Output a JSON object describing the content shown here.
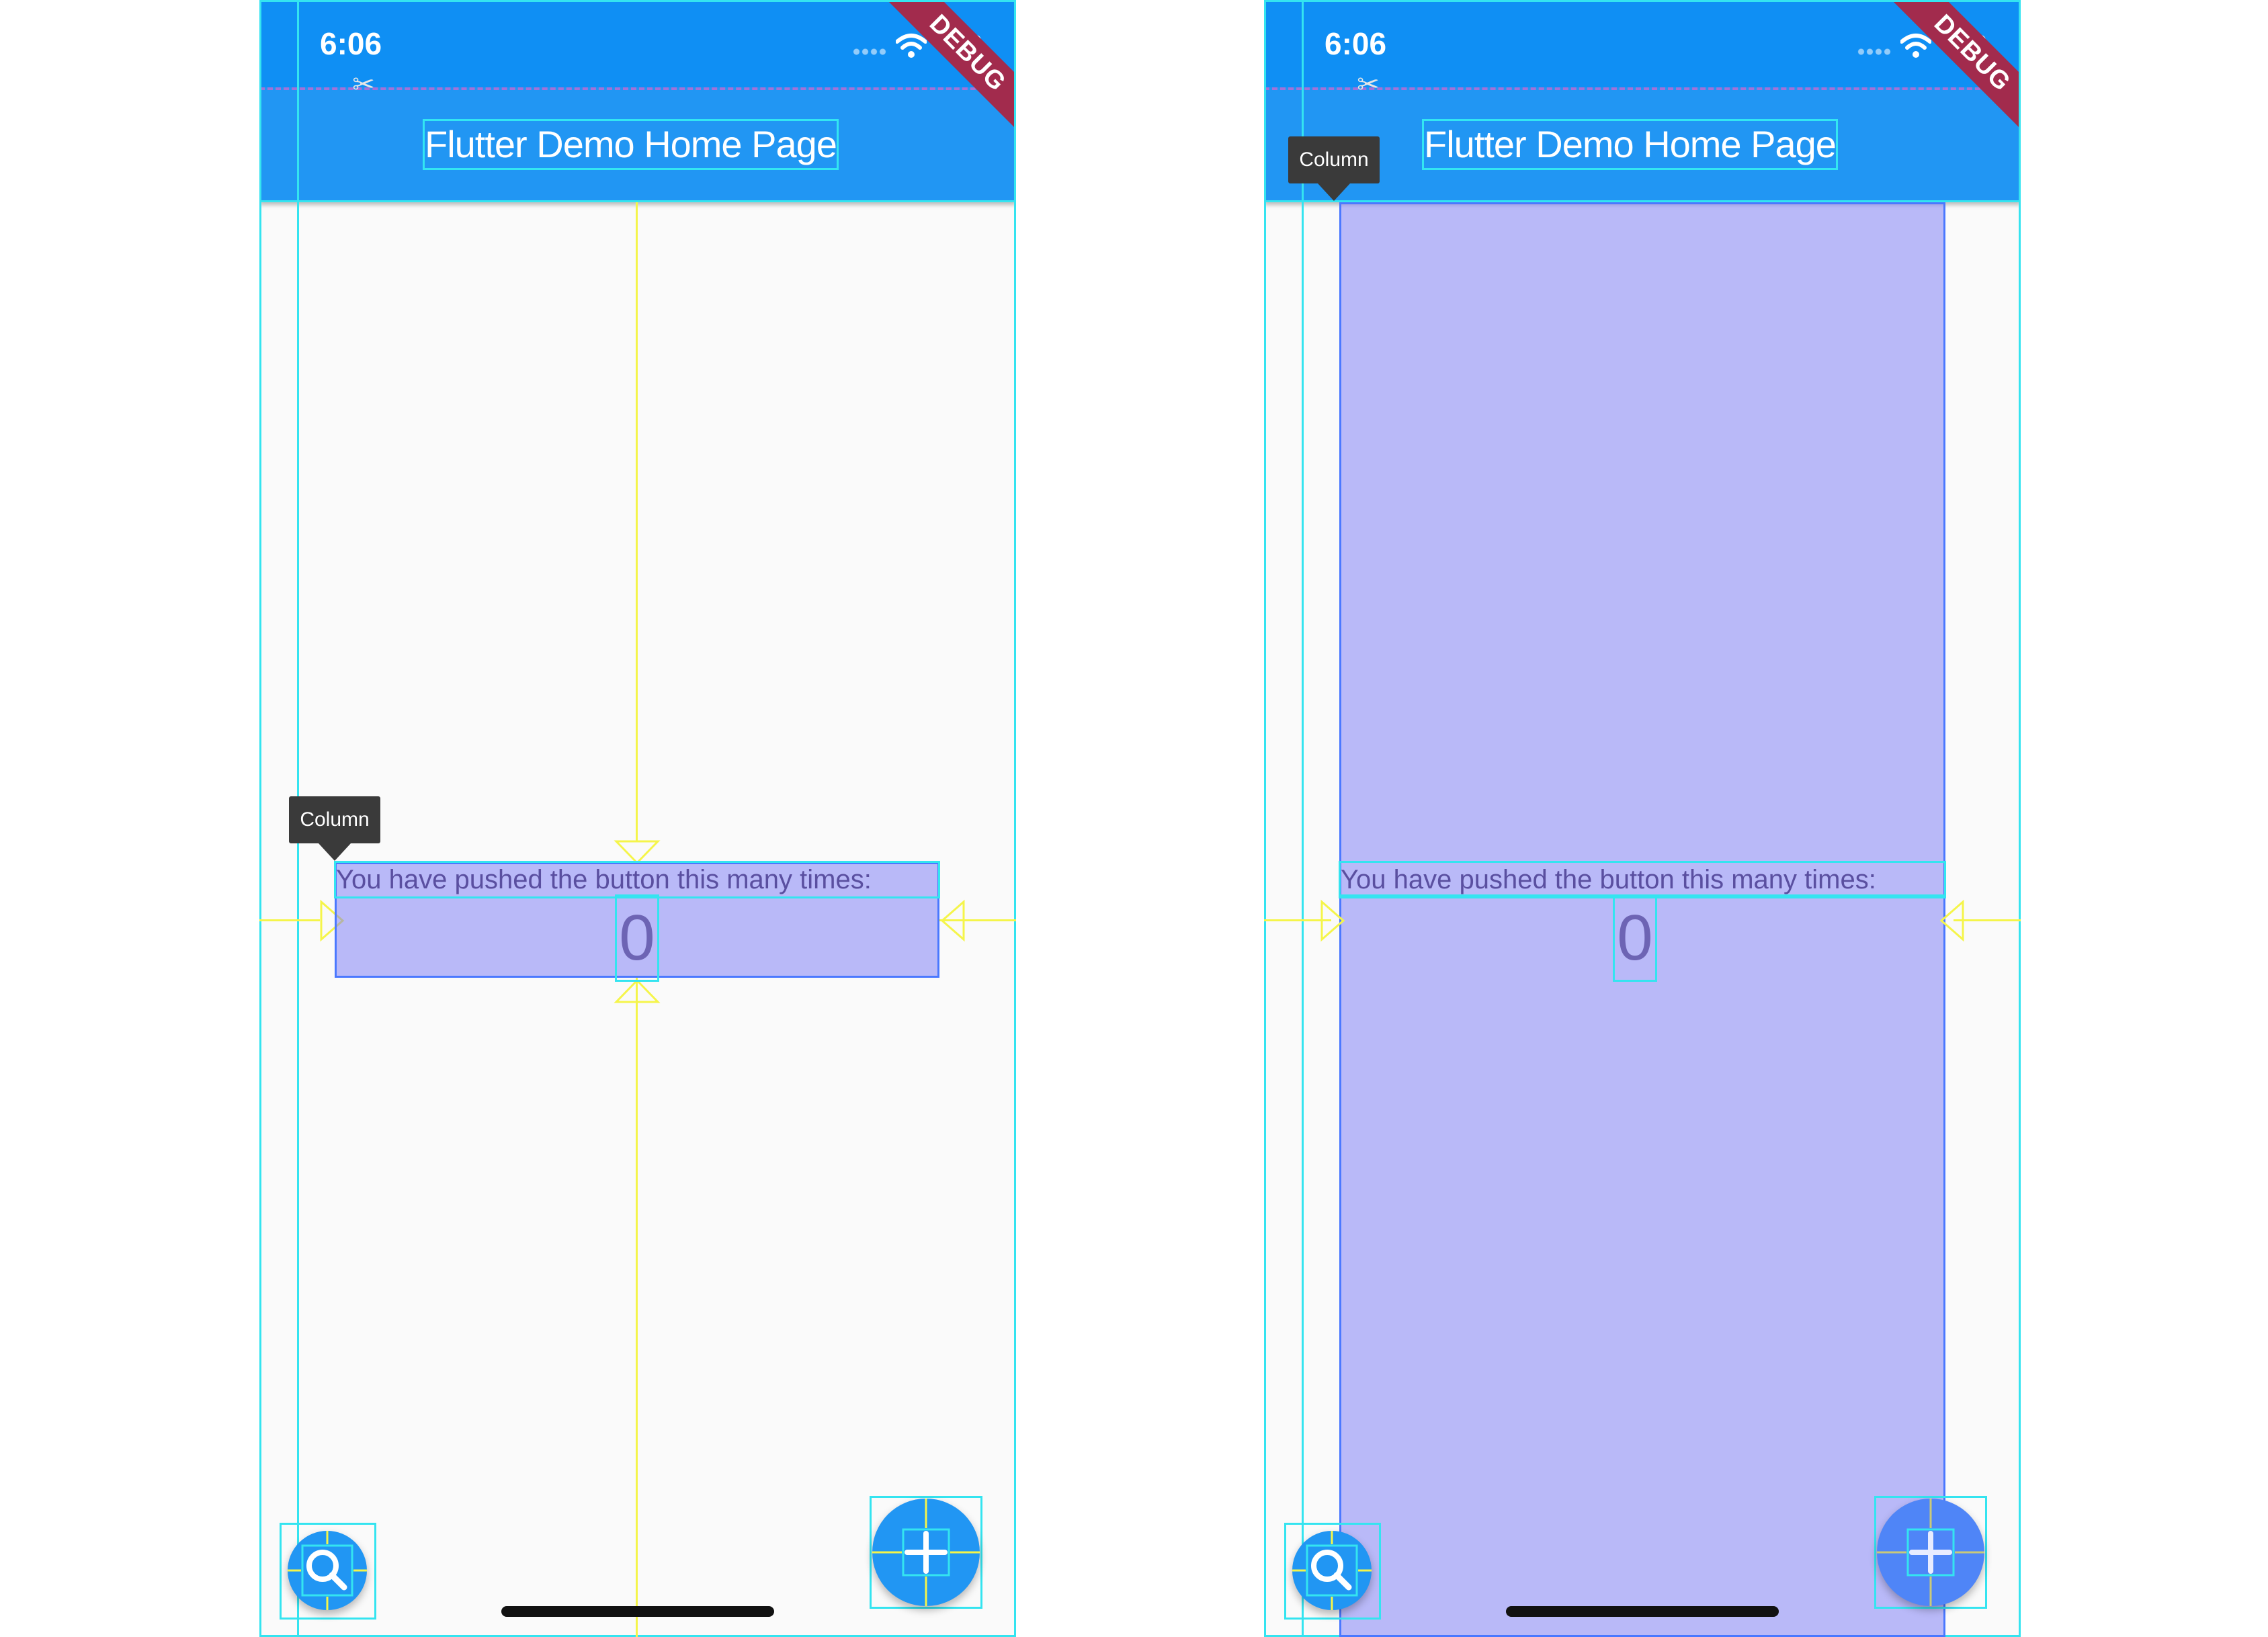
{
  "status_bar": {
    "time": "6:06"
  },
  "debug_banner": "DEBUG",
  "app_bar": {
    "title": "Flutter Demo Home Page"
  },
  "body": {
    "counter_label": "You have pushed the button this many times:",
    "counter_value": "0"
  },
  "inspector": {
    "selected_widget": "Column"
  },
  "fab": {
    "left_icon": "search-icon",
    "right_icon": "add-icon"
  },
  "colors": {
    "app_bar": "#2196f3",
    "status_bar": "#0f8ff4",
    "guide_cyan": "#34e4f0",
    "guide_yellow": "#f5f54a",
    "highlight": "#7878f5",
    "debug_banner": "#a22b4d"
  }
}
